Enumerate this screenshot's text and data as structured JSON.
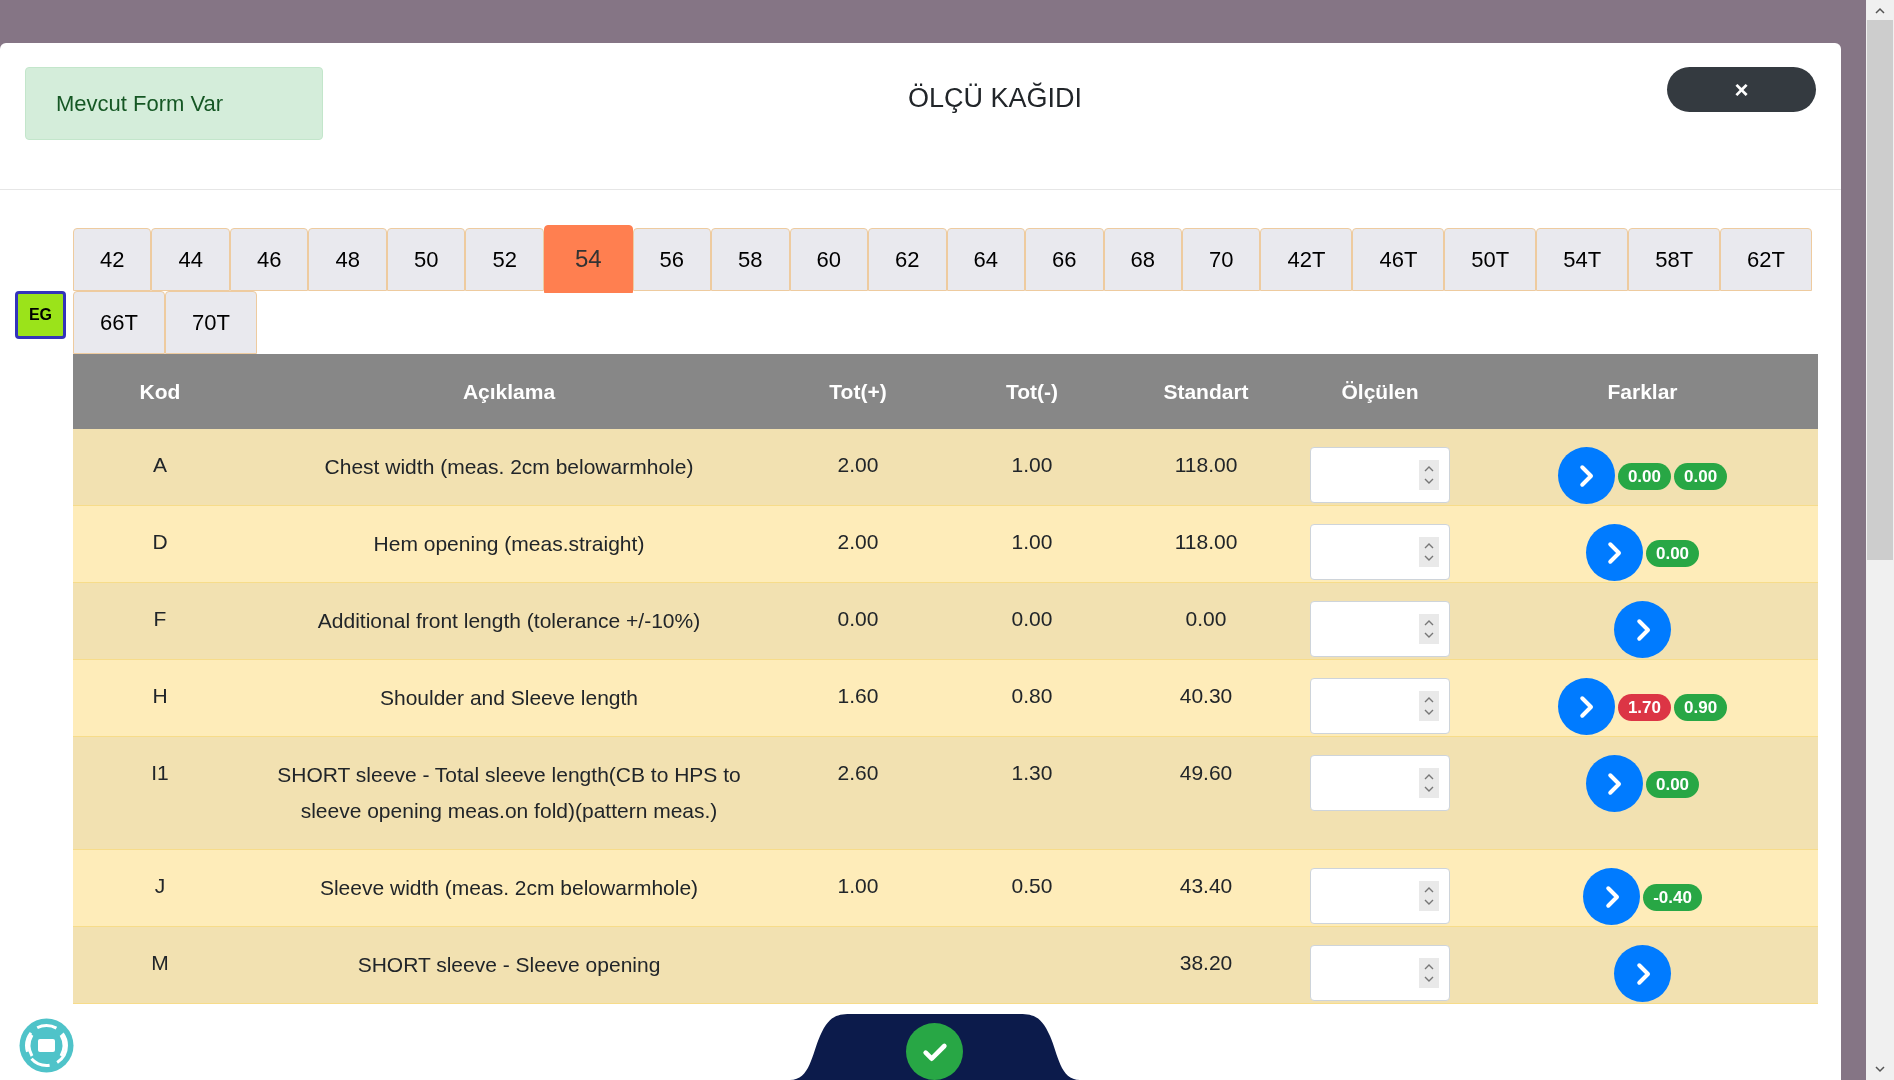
{
  "header": {
    "alert": "Mevcut Form Var",
    "title": "ÖLÇÜ KAĞIDI",
    "close": "×"
  },
  "badge": "EG",
  "sizes": [
    {
      "label": "42",
      "selected": false
    },
    {
      "label": "44",
      "selected": false
    },
    {
      "label": "46",
      "selected": false
    },
    {
      "label": "48",
      "selected": false
    },
    {
      "label": "50",
      "selected": false
    },
    {
      "label": "52",
      "selected": false
    },
    {
      "label": "54",
      "selected": true
    },
    {
      "label": "56",
      "selected": false
    },
    {
      "label": "58",
      "selected": false
    },
    {
      "label": "60",
      "selected": false
    },
    {
      "label": "62",
      "selected": false
    },
    {
      "label": "64",
      "selected": false
    },
    {
      "label": "66",
      "selected": false
    },
    {
      "label": "68",
      "selected": false
    },
    {
      "label": "70",
      "selected": false
    },
    {
      "label": "42T",
      "selected": false
    },
    {
      "label": "46T",
      "selected": false
    },
    {
      "label": "50T",
      "selected": false
    },
    {
      "label": "54T",
      "selected": false
    },
    {
      "label": "58T",
      "selected": false
    },
    {
      "label": "62T",
      "selected": false
    },
    {
      "label": "66T",
      "selected": false
    },
    {
      "label": "70T",
      "selected": false
    }
  ],
  "table": {
    "columns": [
      "Kod",
      "Açıklama",
      "Tot(+)",
      "Tot(-)",
      "Standart",
      "Ölçülen",
      "Farklar"
    ],
    "rows": [
      {
        "kod": "A",
        "aciklama": "Chest width (meas. 2cm belowarmhole)",
        "tot_plus": "2.00",
        "tot_minus": "1.00",
        "standart": "118.00",
        "farklar": [
          {
            "text": "0.00",
            "color": "#28a745"
          },
          {
            "text": "0.00",
            "color": "#28a745"
          }
        ]
      },
      {
        "kod": "D",
        "aciklama": "Hem opening (meas.straight)",
        "tot_plus": "2.00",
        "tot_minus": "1.00",
        "standart": "118.00",
        "farklar": [
          {
            "text": "0.00",
            "color": "#28a745"
          }
        ]
      },
      {
        "kod": "F",
        "aciklama": "Additional front length (tolerance +/-10%)",
        "tot_plus": "0.00",
        "tot_minus": "0.00",
        "standart": "0.00",
        "farklar": []
      },
      {
        "kod": "H",
        "aciklama": "Shoulder and Sleeve length",
        "tot_plus": "1.60",
        "tot_minus": "0.80",
        "standart": "40.30",
        "farklar": [
          {
            "text": "1.70",
            "color": "#dc3545"
          },
          {
            "text": "0.90",
            "color": "#28a745"
          }
        ]
      },
      {
        "kod": "I1",
        "aciklama": "SHORT sleeve - Total sleeve length(CB to HPS to sleeve opening meas.on fold)(pattern meas.)",
        "tot_plus": "2.60",
        "tot_minus": "1.30",
        "standart": "49.60",
        "farklar": [
          {
            "text": "0.00",
            "color": "#28a745"
          }
        ]
      },
      {
        "kod": "J",
        "aciklama": "Sleeve width (meas. 2cm belowarmhole)",
        "tot_plus": "1.00",
        "tot_minus": "0.50",
        "standart": "43.40",
        "farklar": [
          {
            "text": "-0.40",
            "color": "#28a745"
          }
        ]
      },
      {
        "kod": "M",
        "aciklama": "SHORT sleeve - Sleeve opening",
        "standart": "38.20",
        "farklar": []
      }
    ]
  }
}
